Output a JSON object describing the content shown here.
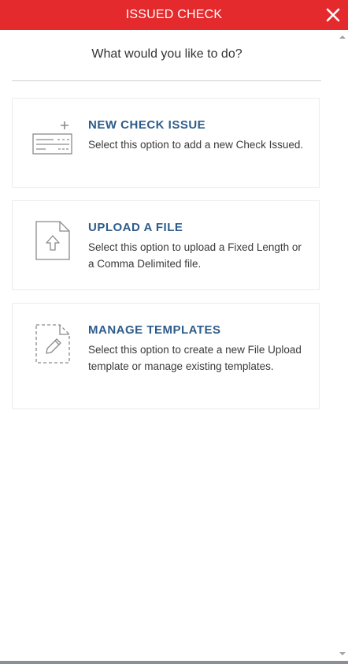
{
  "header": {
    "title": "ISSUED CHECK",
    "close_icon": "close-icon"
  },
  "prompt": "What would you like to do?",
  "options": [
    {
      "title": "NEW CHECK ISSUE",
      "description": "Select this option to add a new Check Issued.",
      "icon": "check-add-icon"
    },
    {
      "title": "UPLOAD A FILE",
      "description": "Select this option to upload a Fixed Length or a Comma Delimited file.",
      "icon": "file-upload-icon"
    },
    {
      "title": "MANAGE TEMPLATES",
      "description": "Select this option to create a new File Upload template or manage existing templates.",
      "icon": "template-edit-icon"
    }
  ],
  "colors": {
    "header_bg": "#e42a2c",
    "title_text": "#2e5c8a",
    "icon_stroke": "#8a8a8a"
  }
}
